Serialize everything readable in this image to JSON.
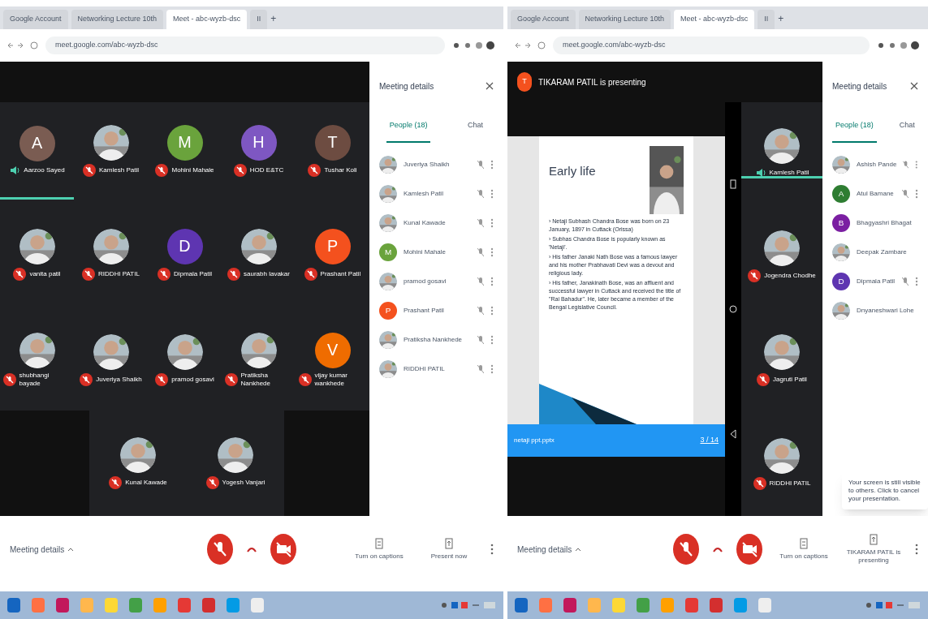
{
  "screens": [
    {
      "kind": "grid",
      "browser": {
        "tabs": [
          {
            "title": "Google Account",
            "selected": false
          },
          {
            "title": "Networking Lecture 10th",
            "selected": false
          },
          {
            "title": "Meet - abc-wyzb-dsc",
            "selected": true
          },
          {
            "title": "II",
            "selected": false
          }
        ],
        "new_tab": "+",
        "url": "meet.google.com/abc-wyzb-dsc"
      },
      "tiles": [
        {
          "name": "Aarzoo Sayed",
          "kind": "initial",
          "initial": "A",
          "color": "#7a5c52",
          "muted": false
        },
        {
          "name": "Kamlesh Patil",
          "muted": true
        },
        {
          "name": "Mohini Mahale",
          "kind": "initial",
          "initial": "M",
          "color": "#6aa33c",
          "muted": true
        },
        {
          "name": "HOD E&TC",
          "kind": "initial",
          "initial": "H",
          "color": "#7e57c2",
          "muted": true
        },
        {
          "name": "Tushar Koli",
          "kind": "initial",
          "initial": "T",
          "color": "#6d4c41",
          "muted": true
        },
        {
          "name": "vanita patil",
          "muted": true
        },
        {
          "name": "RIDDHI PATIL",
          "muted": true
        },
        {
          "name": "Dipmala Patil",
          "kind": "initial",
          "initial": "D",
          "color": "#5e35b1",
          "muted": true
        },
        {
          "name": "saurabh lavakar",
          "muted": true
        },
        {
          "name": "Prashant Patil",
          "kind": "initial",
          "initial": "P",
          "color": "#f4511e",
          "muted": true
        },
        {
          "name": "shubhangi bayade",
          "muted": true
        },
        {
          "name": "Juveriya Shaikh",
          "muted": true
        },
        {
          "name": "pramod gosavi",
          "muted": true
        },
        {
          "name": "Pratiksha Nankhede",
          "muted": true
        },
        {
          "name": "vijay kumar wankhede",
          "kind": "initial",
          "initial": "V",
          "color": "#ef6c00",
          "muted": true
        },
        {
          "name": "Kunal Kawade",
          "muted": true
        },
        {
          "name": "Yogesh Vanjari",
          "muted": true
        }
      ],
      "panel": {
        "title": "Meeting details",
        "tabs": [
          {
            "label": "People (18)",
            "selected": true
          },
          {
            "label": "Chat",
            "selected": false
          }
        ],
        "people": [
          {
            "name": "Juveriya Shaikh"
          },
          {
            "name": "Kamlesh Patil"
          },
          {
            "name": "Kunal Kawade"
          },
          {
            "name": "Mohini Mahale",
            "kind": "initial",
            "initial": "M",
            "color": "#6aa33c"
          },
          {
            "name": "pramod gosavi"
          },
          {
            "name": "Prashant Patil",
            "kind": "initial",
            "initial": "P",
            "color": "#f4511e"
          },
          {
            "name": "Pratiksha Nankhede"
          },
          {
            "name": "RIDDHI PATIL"
          }
        ]
      },
      "controls": {
        "details": "Meeting details",
        "actions": [
          "Turn on captions",
          "Present now"
        ]
      }
    },
    {
      "kind": "presenting",
      "browser": {
        "tabs": [
          {
            "title": "Google Account",
            "selected": false
          },
          {
            "title": "Networking Lecture 10th",
            "selected": false
          },
          {
            "title": "Meet - abc-wyzb-dsc",
            "selected": true
          },
          {
            "title": "II",
            "selected": false
          }
        ],
        "new_tab": "+",
        "url": "meet.google.com/abc-wyzb-dsc"
      },
      "presenter": {
        "initial": "T",
        "text": "TIKARAM PATIL is presenting"
      },
      "slide": {
        "title": "Early life",
        "bullets": [
          "› Netaji Subhash Chandra Bose was born on 23 January, 1897 in Cuttack (Orissa)",
          "› Subhas Chandra Bose is popularly known as 'Netaji'.",
          "› His father Janaki Nath Bose was a famous lawyer and his mother Prabhavati Devi was a devout and religious lady.",
          "› His father, Janakinath Bose, was an affluent and successful lawyer in Cuttack and received the title of \"Rai Bahadur\". He, later became a member of the Bengal Legislative Council."
        ],
        "file": "netaji ppt.pptx",
        "page": "3 / 14"
      },
      "tiles": [
        {
          "name": "Kamlesh Patil",
          "muted": false
        },
        {
          "name": "Jogendra Chodhe",
          "muted": true
        },
        {
          "name": "Jagruti Patil",
          "muted": true
        },
        {
          "name": "RIDDHI PATIL",
          "muted": true
        }
      ],
      "panel": {
        "title": "Meeting details",
        "tabs": [
          {
            "label": "People (18)",
            "selected": true
          },
          {
            "label": "Chat",
            "selected": false
          }
        ],
        "people": [
          {
            "name": "Ashish Pande"
          },
          {
            "name": "Atul Bamane",
            "kind": "initial",
            "initial": "A",
            "color": "#2e7d32"
          },
          {
            "name": "Bhagyashri Bhagat",
            "kind": "initial",
            "initial": "B",
            "color": "#7b1fa2"
          },
          {
            "name": "Deepak Zambare"
          },
          {
            "name": "Dipmala Patil",
            "kind": "initial",
            "initial": "D",
            "color": "#5e35b1"
          },
          {
            "name": "Dnyaneshwari Lohe"
          }
        ]
      },
      "toast": "Your screen is still visible to others. Click to cancel your presentation.",
      "controls": {
        "details": "Meeting details",
        "actions": [
          "Turn on captions",
          "TIKARAM PATIL is presenting"
        ]
      }
    }
  ]
}
